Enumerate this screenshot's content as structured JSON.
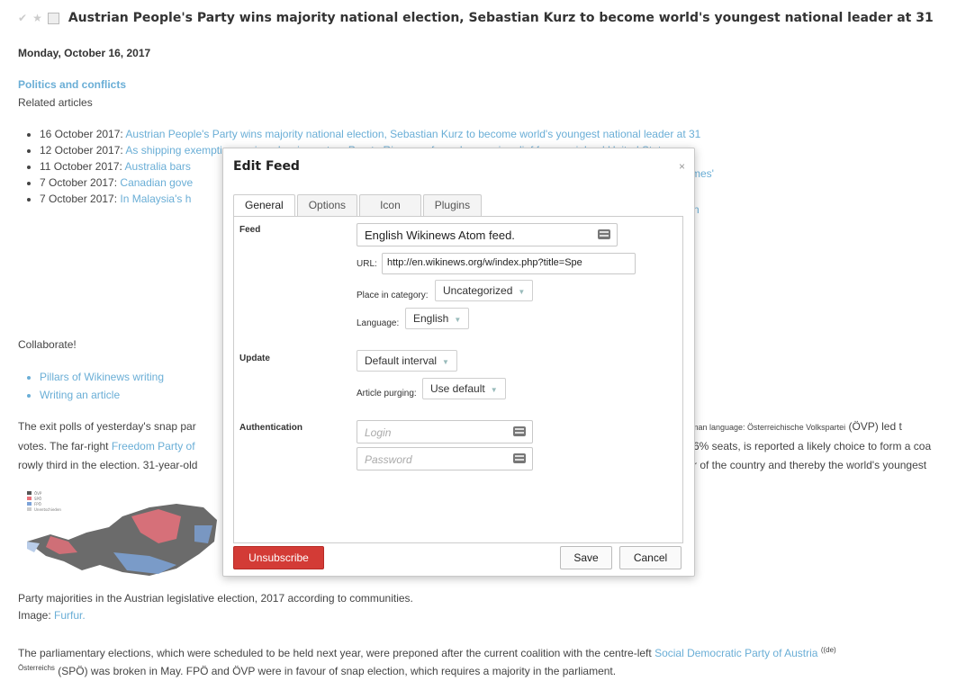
{
  "article": {
    "headline": "Austrian People's Party wins majority national election, Sebastian Kurz to become world's youngest national leader at 31",
    "date": "Monday, October 16, 2017",
    "category": "Politics and conflicts",
    "related_label": "Related articles",
    "related": [
      {
        "date": "16 October 2017:",
        "title": "Austrian People's Party wins majority national election, Sebastian Kurz to become world's youngest national leader at 31"
      },
      {
        "date": "12 October 2017:",
        "title": "As shipping exemption expires, hurricane-torn Puerto Rico may face changes in relief from mainland United States"
      },
      {
        "date": "11 October 2017:",
        "title": "Australia bars",
        "tail": "mes'"
      },
      {
        "date": "7 October 2017:",
        "title": "Canadian gove"
      },
      {
        "date": "7 October 2017:",
        "title": "In Malaysia's h",
        "tail": "n"
      }
    ],
    "collaborate_label": "Collaborate!",
    "collaborate": [
      "Pillars of Wikinews writing",
      "Writing an article"
    ],
    "para1": [
      {
        "left": "The exit polls of yesterday's snap par",
        "right": "erman language: Österreichische Volkspartei",
        "right2": "(ÖVP) led t"
      },
      {
        "left": "votes. The far-right ",
        "left_link": "Freedom Party of",
        "right": "6% seats, is reported a likely choice to form a coa"
      },
      {
        "left": "rowly third in the election. 31-year-old",
        "right": "r of the country and thereby the world's youngest"
      }
    ],
    "map_legend": [
      "ÖVP",
      "SPÖ",
      "FPÖ",
      "Unentschieden"
    ],
    "caption": "Party majorities in the Austrian legislative election, 2017 according to communities.",
    "image_label": "Image:",
    "image_credit": "Furfur.",
    "para2_line1": "The parliamentary elections, which were scheduled to be held next year, were preponed after the current coalition with the centre-left ",
    "para2_link": "Social Democratic Party of Austria",
    "para2_sup": "((de)",
    "para2_line2_sup": "Österreichs",
    "para2_line2": "(SPÖ) was broken in May. FPÖ and ÖVP were in favour of snap election, which requires a majority in the parliament."
  },
  "dialog": {
    "title": "Edit Feed",
    "close": "×",
    "tabs": [
      "General",
      "Options",
      "Icon",
      "Plugins"
    ],
    "sections": {
      "feed": "Feed",
      "update": "Update",
      "auth": "Authentication"
    },
    "feed_title": "English Wikinews Atom feed.",
    "url_label": "URL:",
    "url_value": "http://en.wikinews.org/w/index.php?title=Spe",
    "category_label": "Place in category:",
    "category_value": "Uncategorized",
    "language_label": "Language:",
    "language_value": "English",
    "interval_value": "Default interval",
    "purging_label": "Article purging:",
    "purging_value": "Use default",
    "login_placeholder": "Login",
    "password_placeholder": "Password",
    "unsubscribe": "Unsubscribe",
    "save": "Save",
    "cancel": "Cancel"
  },
  "colors": {
    "link": "#6aaed6",
    "danger": "#d33b36"
  }
}
